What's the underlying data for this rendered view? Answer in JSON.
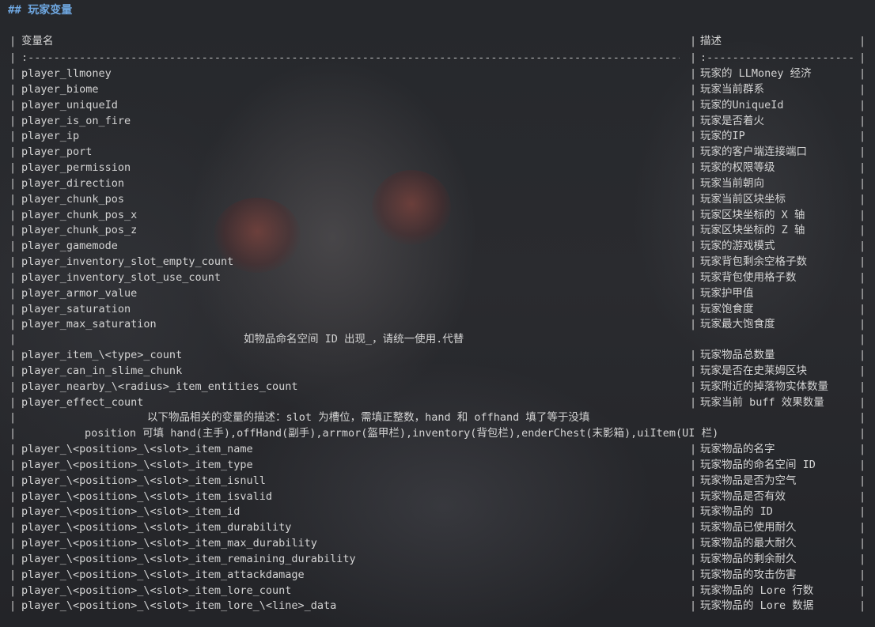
{
  "heading": "## 玩家变量",
  "table": {
    "header": [
      "变量名",
      "描述"
    ],
    "separator": [
      ":-----------------------------------------------------------------------------------------------------------",
      ":-------------------------"
    ],
    "rows_a": [
      [
        "player_llmoney",
        "玩家的 LLMoney 经济"
      ],
      [
        "player_biome",
        "玩家当前群系"
      ],
      [
        "player_uniqueId",
        "玩家的UniqueId"
      ],
      [
        "player_is_on_fire",
        "玩家是否着火"
      ],
      [
        "player_ip",
        "玩家的IP"
      ],
      [
        "player_port",
        "玩家的客户端连接端口"
      ],
      [
        "player_permission",
        "玩家的权限等级"
      ],
      [
        "player_direction",
        "玩家当前朝向"
      ],
      [
        "player_chunk_pos",
        "玩家当前区块坐标"
      ],
      [
        "player_chunk_pos_x",
        "玩家区块坐标的 X 轴"
      ],
      [
        "player_chunk_pos_z",
        "玩家区块坐标的 Z 轴"
      ],
      [
        "player_gamemode",
        "玩家的游戏模式"
      ],
      [
        "player_inventory_slot_empty_count",
        "玩家背包剩余空格子数"
      ],
      [
        "player_inventory_slot_use_count",
        "玩家背包使用格子数"
      ],
      [
        "player_armor_value",
        "玩家护甲值"
      ],
      [
        "player_saturation",
        "玩家饱食度"
      ],
      [
        "player_max_saturation",
        "玩家最大饱食度"
      ]
    ],
    "note_1": "如物品命名空间 ID 出现_，请统一使用.代替",
    "rows_b": [
      [
        "player_item_\\<type>_count",
        "玩家物品总数量"
      ],
      [
        "player_can_in_slime_chunk",
        "玩家是否在史莱姆区块"
      ],
      [
        "player_nearby_\\<radius>_item_entities_count",
        "玩家附近的掉落物实体数量"
      ],
      [
        "player_effect_count",
        "玩家当前 buff 效果数量"
      ]
    ],
    "note_2": "以下物品相关的变量的描述：slot 为槽位，需填正整数，hand 和 offhand 填了等于没填",
    "note_3": "position 可填 hand(主手),offHand(副手),arrmor(盔甲栏),inventory(背包栏),enderChest(末影箱),uiItem(UI 栏)",
    "rows_c": [
      [
        "player_\\<position>_\\<slot>_item_name",
        "玩家物品的名字"
      ],
      [
        "player_\\<position>_\\<slot>_item_type",
        "玩家物品的命名空间 ID"
      ],
      [
        "player_\\<position>_\\<slot>_item_isnull",
        "玩家物品是否为空气"
      ],
      [
        "player_\\<position>_\\<slot>_item_isvalid",
        "玩家物品是否有效"
      ],
      [
        "player_\\<position>_\\<slot>_item_id",
        "玩家物品的 ID"
      ],
      [
        "player_\\<position>_\\<slot>_item_durability",
        "玩家物品已使用耐久"
      ],
      [
        "player_\\<position>_\\<slot>_item_max_durability",
        "玩家物品的最大耐久"
      ],
      [
        "player_\\<position>_\\<slot>_item_remaining_durability",
        "玩家物品的剩余耐久"
      ],
      [
        "player_\\<position>_\\<slot>_item_attackdamage",
        "玩家物品的攻击伤害"
      ],
      [
        "player_\\<position>_\\<slot>_item_lore_count",
        "玩家物品的 Lore 行数"
      ],
      [
        "player_\\<position>_\\<slot>_item_lore_\\<line>_data",
        "玩家物品的 Lore 数据"
      ]
    ]
  },
  "colors": {
    "heading": "#6ea6df",
    "text": "#d4d4d4",
    "background": "#1e2023"
  }
}
